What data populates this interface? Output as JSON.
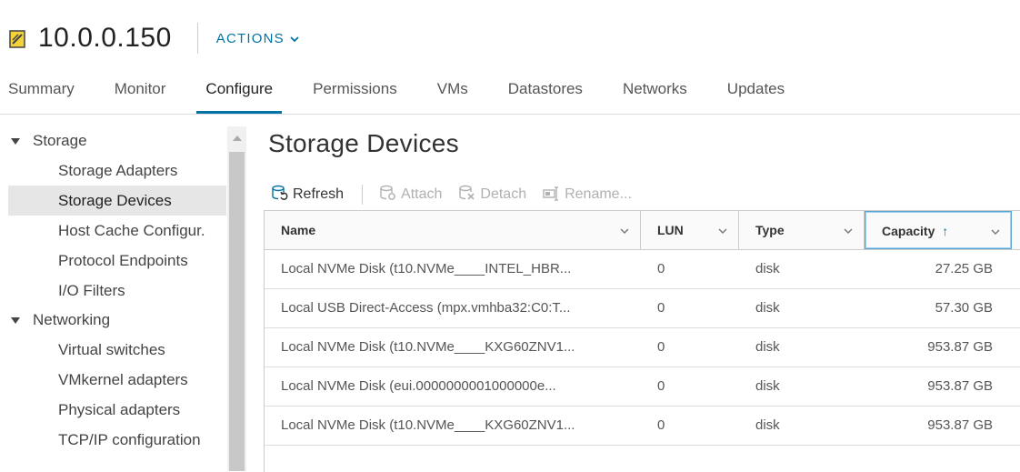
{
  "header": {
    "host_name": "10.0.0.150",
    "actions_label": "ACTIONS",
    "host_icon": "host-server-icon"
  },
  "tabs": [
    {
      "label": "Summary",
      "active": false
    },
    {
      "label": "Monitor",
      "active": false
    },
    {
      "label": "Configure",
      "active": true
    },
    {
      "label": "Permissions",
      "active": false
    },
    {
      "label": "VMs",
      "active": false
    },
    {
      "label": "Datastores",
      "active": false
    },
    {
      "label": "Networks",
      "active": false
    },
    {
      "label": "Updates",
      "active": false
    }
  ],
  "sidebar": {
    "groups": [
      {
        "label": "Storage",
        "items": [
          "Storage Adapters",
          "Storage Devices",
          "Host Cache Configur.",
          "Protocol Endpoints",
          "I/O Filters"
        ]
      },
      {
        "label": "Networking",
        "items": [
          "Virtual switches",
          "VMkernel adapters",
          "Physical adapters",
          "TCP/IP configuration"
        ]
      }
    ],
    "selected": "Storage Devices"
  },
  "main": {
    "title": "Storage Devices",
    "toolbar": {
      "refresh": "Refresh",
      "attach": "Attach",
      "detach": "Detach",
      "rename": "Rename..."
    },
    "columns": [
      "Name",
      "LUN",
      "Type",
      "Capacity"
    ],
    "sorted_column": "Capacity",
    "rows": [
      {
        "name": "Local NVMe Disk (t10.NVMe____INTEL_HBR...",
        "lun": "0",
        "type": "disk",
        "capacity": "27.25 GB"
      },
      {
        "name": "Local USB Direct-Access (mpx.vmhba32:C0:T...",
        "lun": "0",
        "type": "disk",
        "capacity": "57.30 GB"
      },
      {
        "name": "Local NVMe Disk (t10.NVMe____KXG60ZNV1...",
        "lun": "0",
        "type": "disk",
        "capacity": "953.87 GB"
      },
      {
        "name": "Local NVMe Disk (eui.0000000001000000e...",
        "lun": "0",
        "type": "disk",
        "capacity": "953.87 GB"
      },
      {
        "name": "Local NVMe Disk (t10.NVMe____KXG60ZNV1...",
        "lun": "0",
        "type": "disk",
        "capacity": "953.87 GB"
      }
    ]
  },
  "colors": {
    "accent": "#0072a3",
    "selected_bg": "#e6e6e6"
  }
}
